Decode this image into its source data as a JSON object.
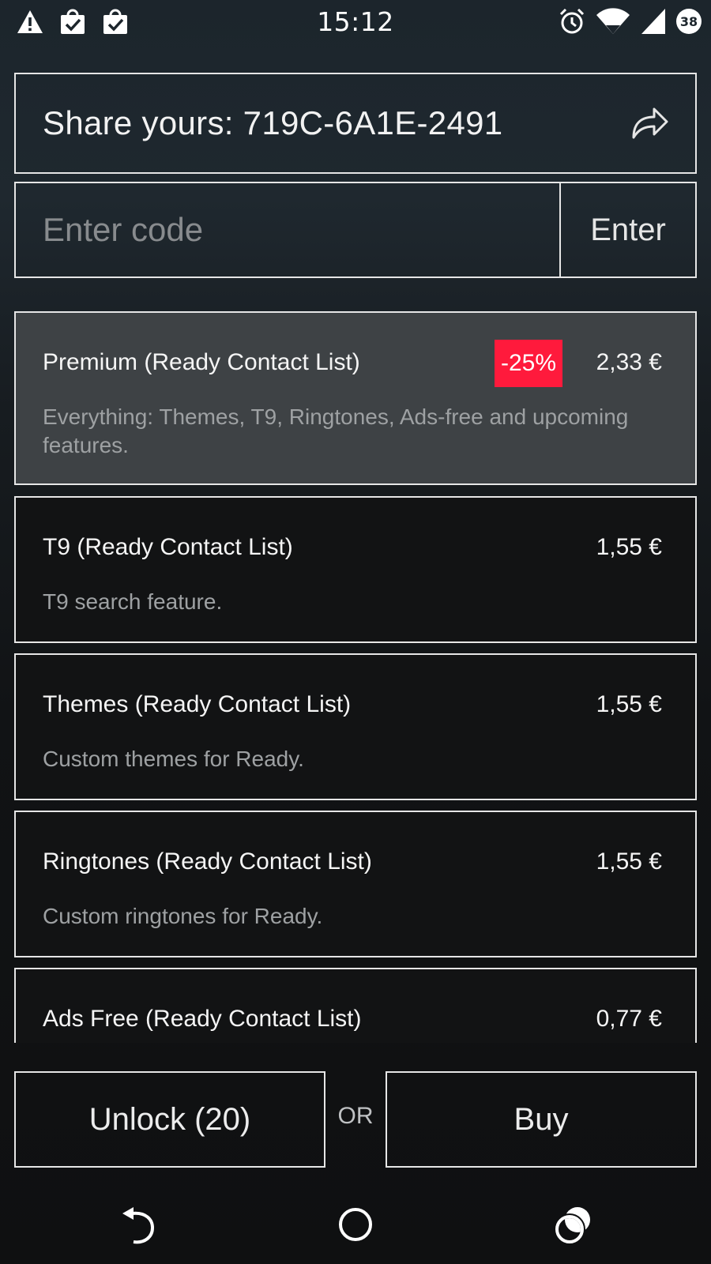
{
  "status_bar": {
    "time": "15:12",
    "battery_level": "38",
    "left_icons": [
      "warning-icon",
      "shopping-bag-check-icon",
      "shopping-bag-check-icon"
    ],
    "right_icons": [
      "alarm-clock-icon",
      "wifi-icon",
      "cell-signal-icon",
      "battery-icon"
    ]
  },
  "share": {
    "text": "Share yours: 719C-6A1E-2491",
    "icon": "share-arrow-icon"
  },
  "code_entry": {
    "placeholder": "Enter code",
    "value": "",
    "enter_label": "Enter"
  },
  "items": [
    {
      "title": "Premium (Ready Contact List)",
      "price": "2,33 €",
      "badge": "-25%",
      "description": "Everything: Themes, T9, Ringtones, Ads-free and upcoming features.",
      "selected": true
    },
    {
      "title": "T9 (Ready Contact List)",
      "price": "1,55 €",
      "description": "T9 search feature.",
      "selected": false
    },
    {
      "title": "Themes (Ready Contact List)",
      "price": "1,55 €",
      "description": "Custom themes for Ready.",
      "selected": false
    },
    {
      "title": "Ringtones (Ready Contact List)",
      "price": "1,55 €",
      "description": "Custom ringtones for Ready.",
      "selected": false
    },
    {
      "title": "Ads Free (Ready Contact List)",
      "price": "0,77 €",
      "description": "",
      "selected": false
    }
  ],
  "actions": {
    "unlock_label": "Unlock (20)",
    "or_label": "OR",
    "buy_label": "Buy"
  },
  "colors": {
    "badge": "#ff1a3c",
    "selected_item_bg": "#3e4245",
    "border": "#e6e6e6"
  },
  "nav_bar": {
    "icons": [
      "back-icon",
      "home-icon",
      "recents-icon"
    ]
  }
}
